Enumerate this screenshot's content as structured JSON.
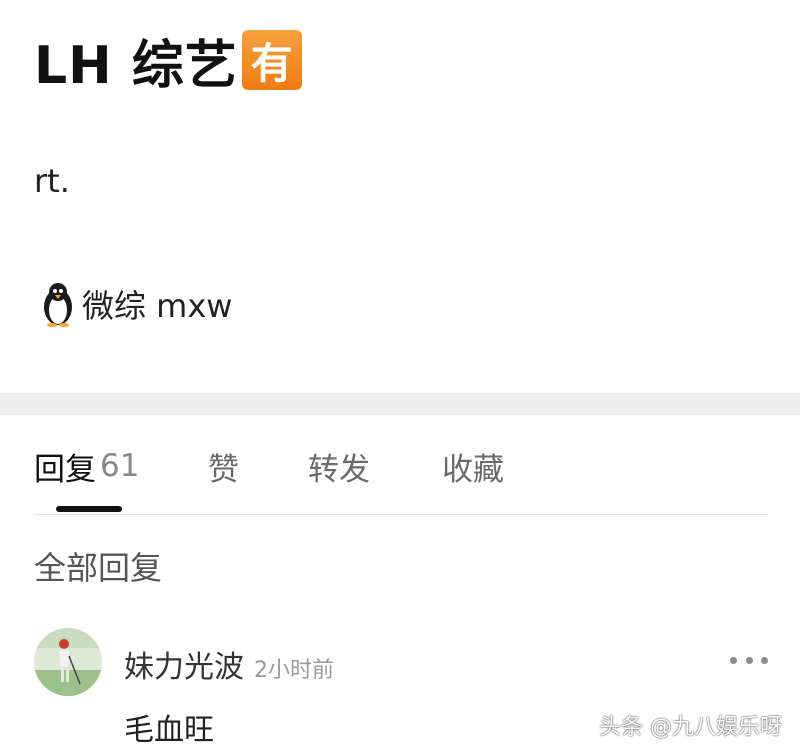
{
  "post": {
    "title": "LH 综艺",
    "badge": "有",
    "body": "rt.",
    "source_text": "微综 mxw",
    "source_icon": "penguin-icon"
  },
  "tabs": [
    {
      "label": "回复",
      "count": "61",
      "active": true
    },
    {
      "label": "赞"
    },
    {
      "label": "转发"
    },
    {
      "label": "收藏"
    }
  ],
  "replies": {
    "heading": "全部回复",
    "items": [
      {
        "username": "妹力光波",
        "time": "2小时前",
        "text": "毛血旺",
        "avatar_icon": "golfer-avatar"
      }
    ]
  },
  "watermark": "头条 @九八娱乐呀",
  "colors": {
    "badge": "#F08A1E",
    "divider": "#EEEEEE",
    "active_tab": "#111111",
    "inactive_tab": "#6A6A6A"
  }
}
